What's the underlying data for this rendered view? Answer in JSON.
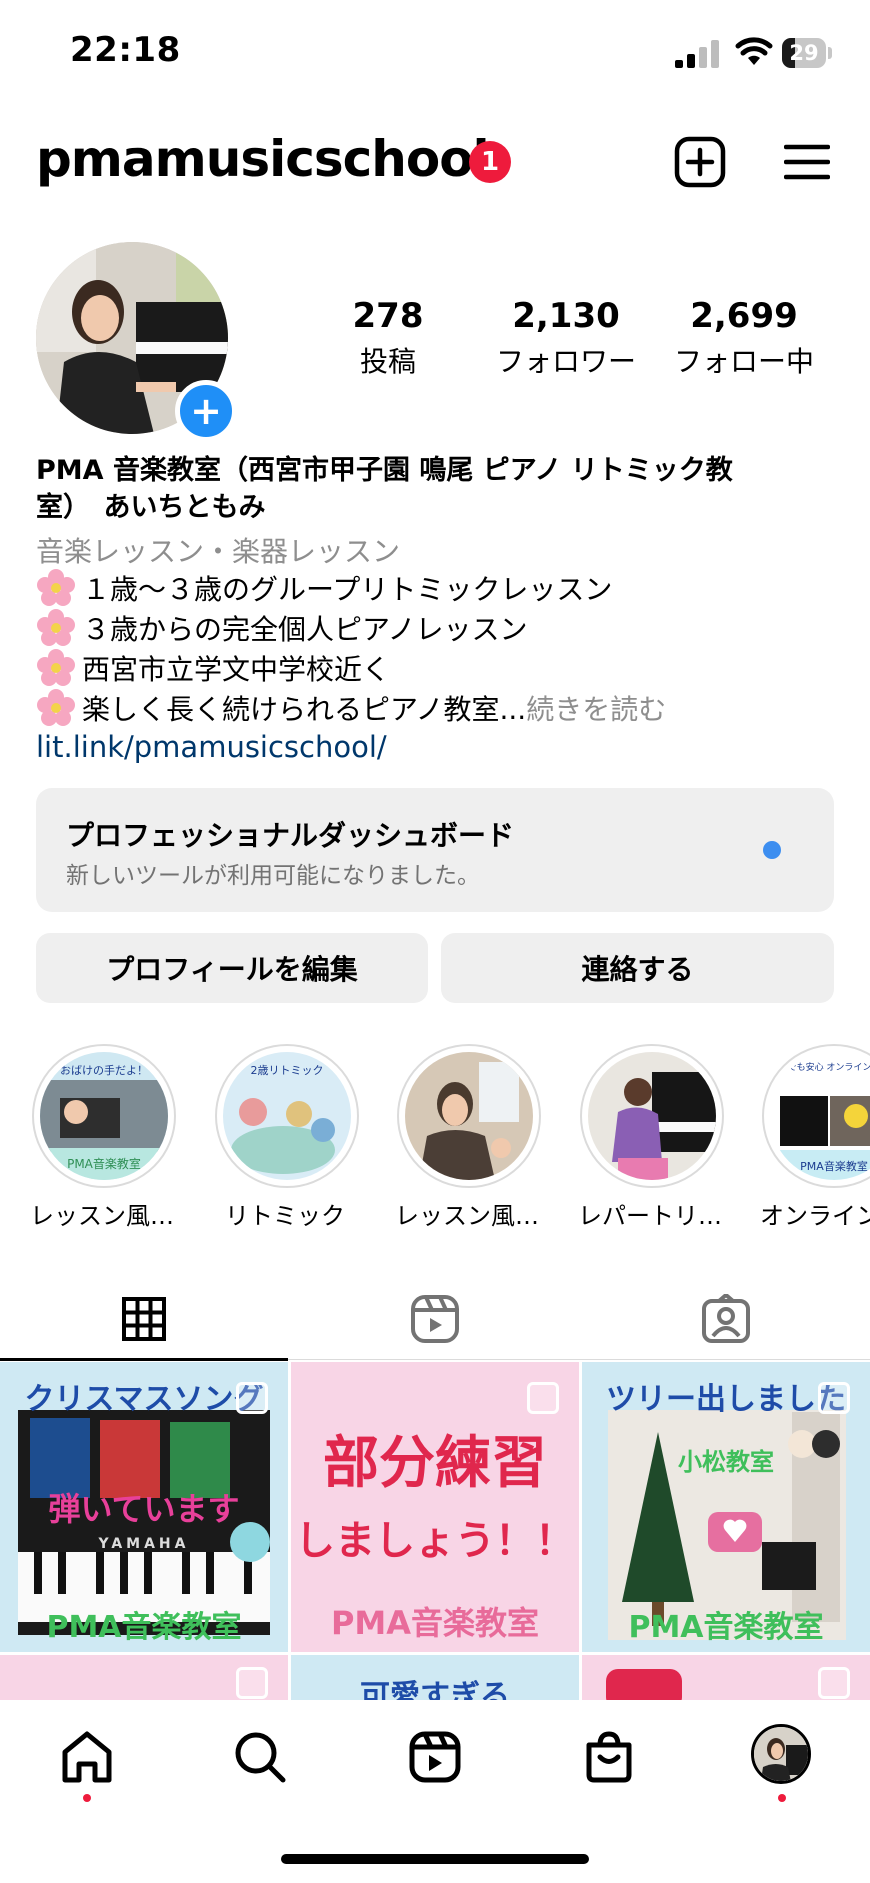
{
  "status_bar": {
    "time": "22:18",
    "battery": "29",
    "battery_level": 0.29
  },
  "header": {
    "username": "pmamusicschool",
    "notification_count": "1"
  },
  "stats": [
    {
      "value": "278",
      "label": "投稿"
    },
    {
      "value": "2,130",
      "label": "フォロワー"
    },
    {
      "value": "2,699",
      "label": "フォロー中"
    }
  ],
  "bio": {
    "name_line1": "PMA 音楽教室（西宮市甲子園 鳴尾 ピアノ リトミック教",
    "name_line2": "室）　あいちともみ",
    "category": "音楽レッスン・楽器レッスン",
    "lines": [
      "１歳〜３歳のグループリトミックレッスン",
      "３歳からの完全個人ピアノレッスン",
      "西宮市立学文中学校近く",
      "楽しく長く続けられるピアノ教室..."
    ],
    "more": " 続きを読む",
    "link": "lit.link/pmamusicschool/"
  },
  "dashboard": {
    "title": "プロフェッショナルダッシュボード",
    "subtitle": "新しいツールが利用可能になりました。"
  },
  "buttons": {
    "edit": "プロフィールを編集",
    "contact": "連絡する"
  },
  "highlights": [
    {
      "label": "レッスン風…",
      "caption": "おばけの手だよ！",
      "badge": "PMA音楽教室"
    },
    {
      "label": "リトミック",
      "caption": "2歳リトミック"
    },
    {
      "label": "レッスン風…"
    },
    {
      "label": "レパートリ…"
    },
    {
      "label": "オンライン",
      "caption": "カゼや大雨でも安心 オンラインレッスン対応",
      "badge": "PMA音楽教室"
    }
  ],
  "posts": [
    {
      "top": "クリスマスソング",
      "mid": "弾いています",
      "brand": "YAMAHA",
      "bottom": "PMA音楽教室"
    },
    {
      "top": "部分練習",
      "mid": "しましょう！！",
      "bottom": "PMA音楽教室"
    },
    {
      "top": "ツリー出しました",
      "mid": "小松教室",
      "bottom": "PMA音楽教室"
    },
    {
      "top": ""
    },
    {
      "top": "可愛すぎる"
    },
    {
      "top": ""
    }
  ],
  "colors": {
    "accent": "#1f8ff7",
    "badge": "#ee1b3c",
    "link": "#00376b",
    "muted": "#8e8e8e"
  }
}
